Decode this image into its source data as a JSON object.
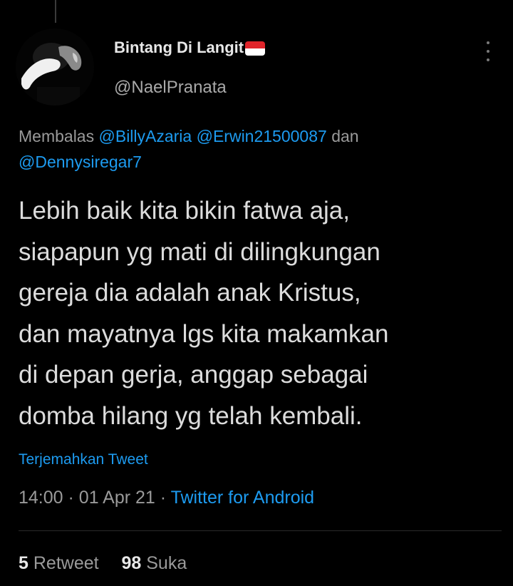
{
  "tweet": {
    "display_name": "Bintang Di Langit",
    "flag_icon": "indonesia-flag-icon",
    "handle": "@NaelPranata",
    "more_icon": "more-vertical-icon",
    "reply_prefix": "Membalas",
    "mentions": [
      "@BillyAzaria",
      "@Erwin21500087",
      "@Dennysiregar7"
    ],
    "reply_conjunction": "dan",
    "body_lines": [
      "Lebih baik kita bikin fatwa aja,",
      "siapapun yg mati di dilingkungan",
      "gereja dia adalah anak Kristus,",
      "dan mayatnya lgs kita makamkan",
      "di depan gerja, anggap sebagai",
      "domba hilang yg telah kembali."
    ],
    "translate_label": "Terjemahkan Tweet",
    "time": "14:00",
    "date": "01 Apr 21",
    "separator": "·",
    "source": "Twitter for Android",
    "retweet_count": "5",
    "retweet_label": "Retweet",
    "like_count": "98",
    "like_label": "Suka"
  },
  "colors": {
    "background": "#000000",
    "text_primary": "#dcdcdc",
    "text_secondary": "#9a9a9a",
    "accent_link": "#1d9bf0",
    "flag_red": "#e0242a",
    "flag_white": "#ffffff"
  }
}
